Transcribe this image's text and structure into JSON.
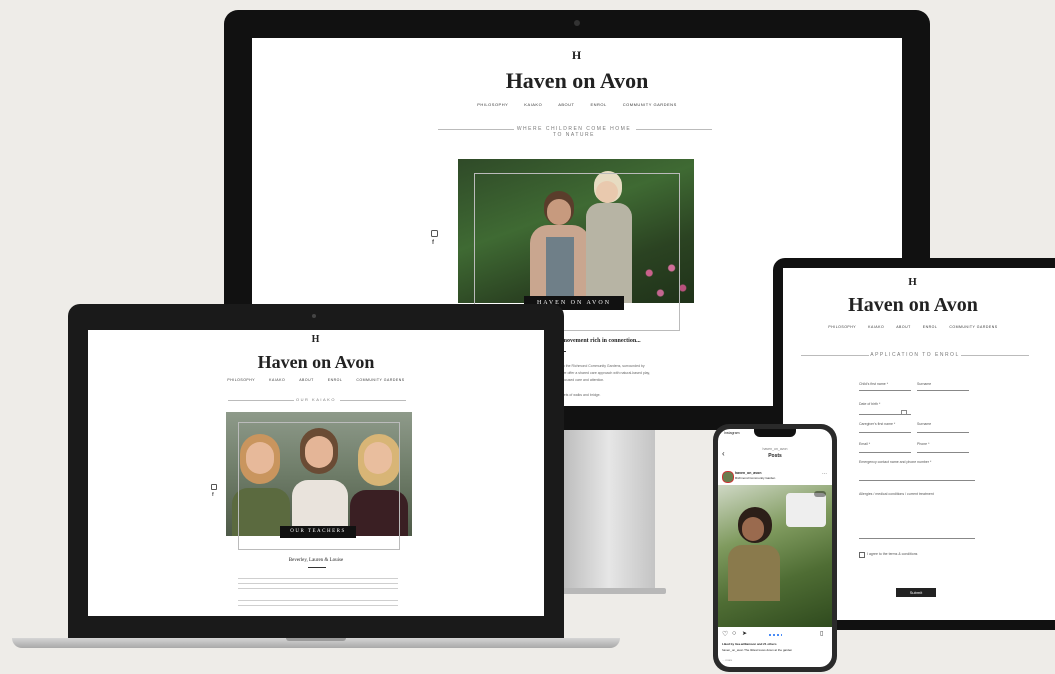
{
  "brand": {
    "monogram": "H",
    "name": "Haven on Avon"
  },
  "desktop": {
    "nav": [
      "PHILOSOPHY",
      "KAIAKO",
      "ABOUT",
      "ENROL",
      "COMMUNITY GARDENS"
    ],
    "tagline": "WHERE CHILDREN COME HOME TO NATURE",
    "photo_caption": "HAVEN ON AVON",
    "section_heading": "movement rich in connection...",
    "body_lines": [
      "in the Richmond Community Gardens, surrounded by",
      "we offer a shared care approach with natural-based play,",
      "focused care and attention.",
      "sets of walks and bridge."
    ]
  },
  "laptop": {
    "nav": [
      "PHILOSOPHY",
      "KAIAKO",
      "ABOUT",
      "ENROL",
      "COMMUNITY GARDENS"
    ],
    "tagline": "OUR KAIAKO",
    "photo_caption": "OUR TEACHERS",
    "names": "Beverley, Lauren & Louise"
  },
  "tablet": {
    "nav": [
      "PHILOSOPHY",
      "KAIAKO",
      "ABOUT",
      "ENROL",
      "COMMUNITY GARDENS"
    ],
    "heading": "APPLICATION TO ENROL",
    "fields": [
      {
        "label": "Child's first name *"
      },
      {
        "label": "Surname"
      },
      {
        "label": "Date of birth *"
      },
      {
        "label": "Caregiver's first name *"
      },
      {
        "label": "Surname"
      },
      {
        "label": "Email *"
      },
      {
        "label": "Phone *"
      },
      {
        "label": "Emergency contact name and phone number *"
      },
      {
        "label": "Allergies / medical conditions / current treatment"
      }
    ],
    "checkbox_label": "I agree to the terms & conditions",
    "submit_label": "Submit"
  },
  "phone": {
    "status_time": "Instagram",
    "header_handle": "haven_on_avon",
    "header_title": "Posts",
    "account": "haven_on_avon",
    "location": "Richmond Community Garden",
    "likes": "Liked by lisa.williamson and 21 others",
    "caption": "haven_on_avon The littlest loves down at the garden",
    "more": "... more"
  },
  "colors": {
    "background": "#eeece8",
    "bezel": "#111111",
    "black_label": "#111111",
    "silver": "#c9c9c9"
  }
}
